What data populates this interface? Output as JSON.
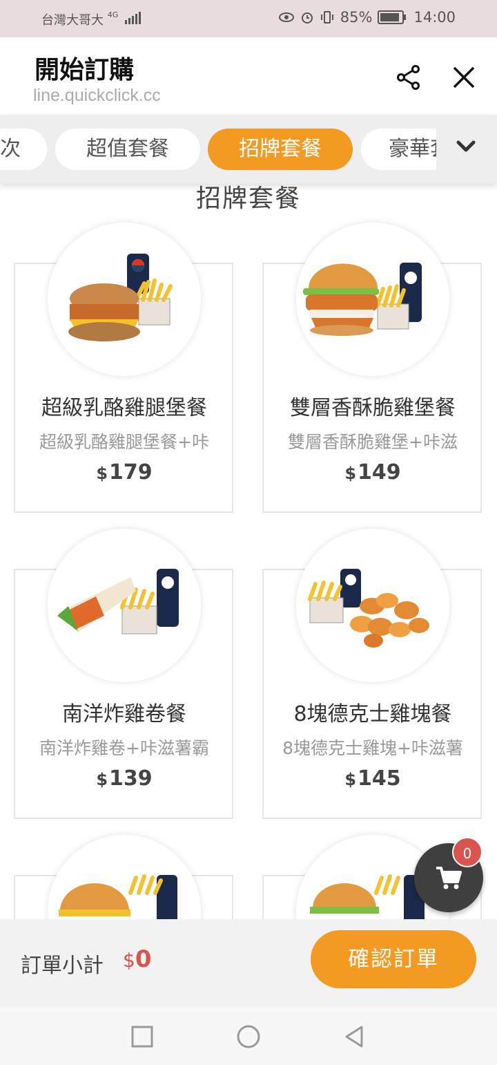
{
  "status_bar": {
    "carrier": "台灣大哥大",
    "network": "4G",
    "battery": "85%",
    "time": "14:00"
  },
  "header": {
    "title": "開始訂購",
    "url": "line.quickclick.cc"
  },
  "tabs": [
    {
      "label": "次",
      "active": false
    },
    {
      "label": "超值套餐",
      "active": false
    },
    {
      "label": "招牌套餐",
      "active": true
    },
    {
      "label": "豪華套餐",
      "active": false
    }
  ],
  "section": {
    "title": "招牌套餐"
  },
  "products": [
    {
      "name": "超級乳酪雞腿堡餐",
      "desc": "超級乳酪雞腿堡餐+咔",
      "currency": "$",
      "price": "179"
    },
    {
      "name": "雙層香酥脆雞堡餐",
      "desc": "雙層香酥脆雞堡+咔滋",
      "currency": "$",
      "price": "149"
    },
    {
      "name": "南洋炸雞卷餐",
      "desc": "南洋炸雞卷+咔滋薯霸",
      "currency": "$",
      "price": "139"
    },
    {
      "name": "8塊德克士雞塊餐",
      "desc": "8塊德克士雞塊+咔滋薯",
      "currency": "$",
      "price": "145"
    }
  ],
  "cart": {
    "count": "0",
    "icon": "cart-icon"
  },
  "order_bar": {
    "subtotal_label": "訂單小計",
    "currency": "$",
    "subtotal": "0",
    "confirm_label": "確認訂單"
  },
  "colors": {
    "accent": "#f39a23",
    "price_red": "#d9534f",
    "cart_dark": "#3f3f3f"
  }
}
